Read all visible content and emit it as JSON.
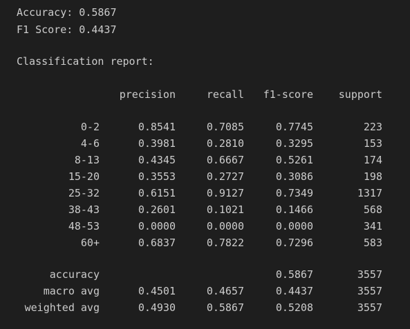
{
  "summary": {
    "accuracy_line": "Accuracy: 0.5867",
    "f1_line": "F1 Score: 0.4437"
  },
  "report": {
    "title": "Classification report:",
    "headers": [
      "precision",
      "recall",
      "f1-score",
      "support"
    ],
    "rows": [
      {
        "label": "0-2",
        "precision": "0.8541",
        "recall": "0.7085",
        "f1": "0.7745",
        "support": "223"
      },
      {
        "label": "4-6",
        "precision": "0.3981",
        "recall": "0.2810",
        "f1": "0.3295",
        "support": "153"
      },
      {
        "label": "8-13",
        "precision": "0.4345",
        "recall": "0.6667",
        "f1": "0.5261",
        "support": "174"
      },
      {
        "label": "15-20",
        "precision": "0.3553",
        "recall": "0.2727",
        "f1": "0.3086",
        "support": "198"
      },
      {
        "label": "25-32",
        "precision": "0.6151",
        "recall": "0.9127",
        "f1": "0.7349",
        "support": "1317"
      },
      {
        "label": "38-43",
        "precision": "0.2601",
        "recall": "0.1021",
        "f1": "0.1466",
        "support": "568"
      },
      {
        "label": "48-53",
        "precision": "0.0000",
        "recall": "0.0000",
        "f1": "0.0000",
        "support": "341"
      },
      {
        "label": "60+",
        "precision": "0.6837",
        "recall": "0.7822",
        "f1": "0.7296",
        "support": "583"
      }
    ],
    "summary_rows": [
      {
        "label": "accuracy",
        "precision": "",
        "recall": "",
        "f1": "0.5867",
        "support": "3557"
      },
      {
        "label": "macro avg",
        "precision": "0.4501",
        "recall": "0.4657",
        "f1": "0.4437",
        "support": "3557"
      },
      {
        "label": "weighted avg",
        "precision": "0.4930",
        "recall": "0.5867",
        "f1": "0.5208",
        "support": "3557"
      }
    ]
  }
}
